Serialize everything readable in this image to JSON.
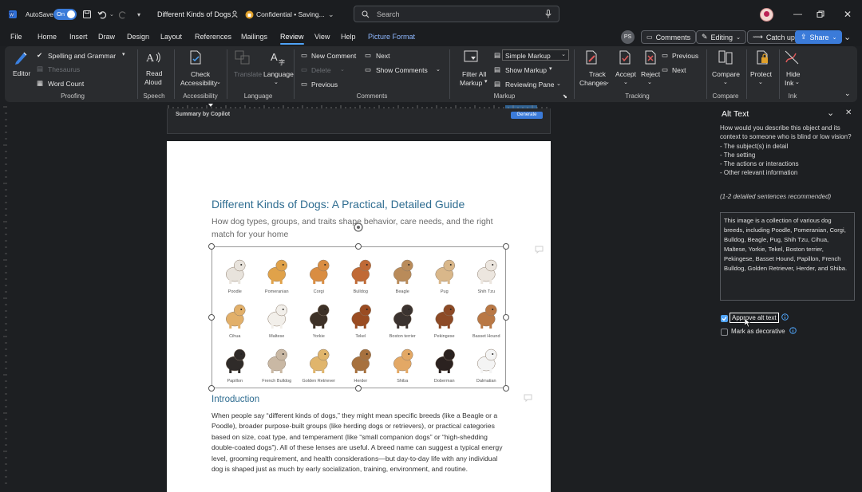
{
  "titlebar": {
    "autosave_label": "AutoSave",
    "autosave_state": "On",
    "doc_name": "Different Kinds of Dogs",
    "sensitivity": "Confidential • Saving...",
    "search_placeholder": "Search"
  },
  "tabs": [
    "File",
    "Home",
    "Insert",
    "Draw",
    "Design",
    "Layout",
    "References",
    "Mailings",
    "Review",
    "View",
    "Help",
    "Picture Format"
  ],
  "top_actions": {
    "presence": "PS",
    "comments": "Comments",
    "editing": "Editing",
    "catchup": "Catch up",
    "share": "Share"
  },
  "ribbon": {
    "proofing": {
      "editor": "Editor",
      "spelling": "Spelling and Grammar",
      "thesaurus": "Thesaurus",
      "word_count": "Word Count",
      "group": "Proofing"
    },
    "speech": {
      "read_aloud_1": "Read",
      "read_aloud_2": "Aloud",
      "group": "Speech"
    },
    "accessibility": {
      "check_1": "Check",
      "check_2": "Accessibility",
      "group": "Accessibility"
    },
    "language": {
      "translate": "Translate",
      "language": "Language",
      "group": "Language"
    },
    "comments": {
      "new": "New Comment",
      "delete": "Delete",
      "previous": "Previous",
      "next": "Next",
      "show": "Show Comments",
      "group": "Comments"
    },
    "markup": {
      "filter_1": "Filter All",
      "filter_2": "Markup",
      "simple": "Simple Markup",
      "show_markup": "Show Markup",
      "reviewing_pane": "Reviewing Pane",
      "group": "Markup"
    },
    "tracking": {
      "track_1": "Track",
      "track_2": "Changes",
      "accept": "Accept",
      "reject": "Reject",
      "previous": "Previous",
      "next": "Next",
      "group": "Tracking"
    },
    "compare": {
      "compare": "Compare",
      "group": "Compare"
    },
    "protect": {
      "protect": "Protect"
    },
    "ink": {
      "hide_1": "Hide",
      "hide_2": "Ink",
      "group": "Ink"
    }
  },
  "copilot": {
    "summary": "Summary by Copilot",
    "generate": "Generate"
  },
  "document": {
    "title": "Different Kinds of Dogs: A Practical, Detailed Guide",
    "subtitle": "How dog types, groups, and traits shape behavior, care needs, and the right match for your home",
    "dogs": [
      "Poodle",
      "Pomeranian",
      "Corgi",
      "Bulldog",
      "Beagle",
      "Pug",
      "Shih Tzu",
      "Cihua",
      "Maltese",
      "Yorkie",
      "Tekel",
      "Boston terrier",
      "Pekingese",
      "Basset Hound",
      "Papillon",
      "French Bulldog",
      "Golden Retriever",
      "Herder",
      "Shiba",
      "Doberman",
      "Dalmatian"
    ],
    "intro_heading": "Introduction",
    "intro_text": "When people say “different kinds of dogs,” they might mean specific breeds (like a Beagle or a Poodle), broader purpose-built groups (like herding dogs or retrievers), or practical categories based on size, coat type, and temperament (like “small companion dogs” or “high-shedding double-coated dogs”). All of these lenses are useful. A breed name can suggest a typical energy level, grooming requirement, and health considerations—but day-to-day life with any individual dog is shaped just as much by early socialization, training, environment, and routine."
  },
  "alt_text_pane": {
    "title": "Alt Text",
    "question": "How would you describe this object and its context to someone who is blind or low vision?",
    "bullets": [
      "- The subject(s) in detail",
      "- The setting",
      "- The actions or interactions",
      "- Other relevant information"
    ],
    "recommendation": "(1-2 detailed sentences recommended)",
    "alt_text": "This image is a collection of various dog breeds, including Poodle, Pomeranian, Corgi, Bulldog, Beagle, Pug, Shih Tzu, Cihua, Maltese, Yorkie, Tekel, Boston terrier, Pekingese, Basset Hound, Papillon, French Bulldog, Golden Retriever, Herder, and Shiba.",
    "approve_label": "Approve alt text",
    "approve_checked": true,
    "decorative_label": "Mark as decorative",
    "decorative_checked": false
  },
  "colors": {
    "accent": "#4fa3f7",
    "heading": "#2f6d91",
    "share_bg": "#3b7bd9"
  }
}
